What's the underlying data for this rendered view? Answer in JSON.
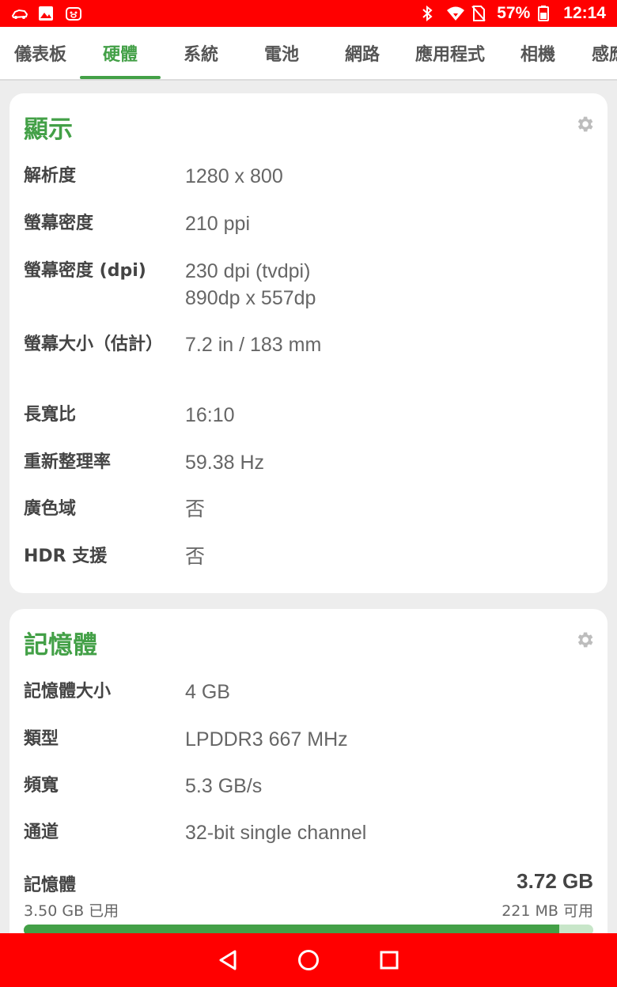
{
  "status_bar": {
    "battery_percent": "57%",
    "time": "12:14",
    "left_icons": [
      "car-notification-icon",
      "image-notification-icon",
      "pig-notification-icon"
    ],
    "right_icons": [
      "bluetooth-icon",
      "wifi-icon",
      "no-sim-icon",
      "battery-icon"
    ],
    "color": "#ff0000"
  },
  "tabs": [
    {
      "label": "儀表板"
    },
    {
      "label": "硬體"
    },
    {
      "label": "系統"
    },
    {
      "label": "電池"
    },
    {
      "label": "網路"
    },
    {
      "label": "應用程式"
    },
    {
      "label": "相機"
    },
    {
      "label": "感應器"
    }
  ],
  "active_tab": "硬體",
  "accent_color": "#43a047",
  "display_card": {
    "title": "顯示",
    "rows": [
      {
        "label": "解析度",
        "value": "1280 x 800"
      },
      {
        "label": "螢幕密度",
        "value": "210 ppi"
      },
      {
        "label": "螢幕密度 (dpi)",
        "value": "230 dpi (tvdpi)",
        "value2": "890dp x 557dp"
      },
      {
        "label": "螢幕大小（估計）",
        "value": "7.2 in / 183 mm"
      },
      {
        "label": "長寬比",
        "value": "16:10"
      },
      {
        "label": "重新整理率",
        "value": "59.38 Hz"
      },
      {
        "label": "廣色域",
        "value": "否"
      },
      {
        "label": "HDR 支援",
        "value": "否"
      }
    ]
  },
  "memory_card": {
    "title": "記憶體",
    "rows": [
      {
        "label": "記憶體大小",
        "value": "4 GB"
      },
      {
        "label": "類型",
        "value": "LPDDR3 667 MHz"
      },
      {
        "label": "頻寬",
        "value": "5.3 GB/s"
      },
      {
        "label": "通道",
        "value": "32-bit single channel"
      }
    ],
    "usage": {
      "label": "記憶體",
      "total": "3.72 GB",
      "used": "3.50 GB 已用",
      "free": "221 MB 可用",
      "used_fraction": 0.94
    }
  },
  "nav_bar": {
    "buttons": [
      "back-icon",
      "home-icon",
      "recents-icon"
    ]
  }
}
